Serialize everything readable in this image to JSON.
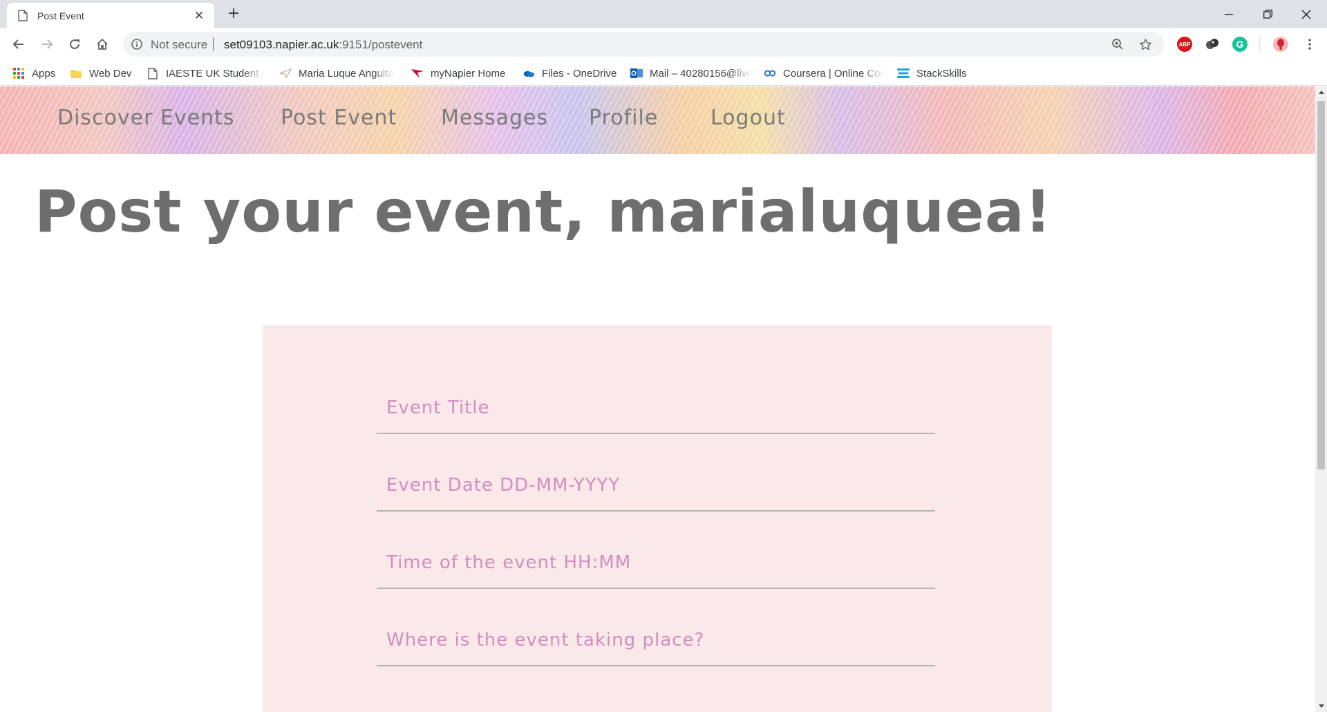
{
  "browser": {
    "tab_title": "Post Event",
    "security_label": "Not secure",
    "url_host": "set09103.napier.ac.uk",
    "url_path": ":9151/postevent",
    "extensions": [
      "abp-icon",
      "ghostery-icon",
      "grammarly-icon",
      "profile-avatar"
    ],
    "bookmarks": [
      {
        "label": "Apps",
        "icon": "apps-grid-icon"
      },
      {
        "label": "Web Dev",
        "icon": "folder-icon"
      },
      {
        "label": "IAESTE UK Student Ap",
        "icon": "page-icon"
      },
      {
        "label": "Maria Luque Anguita",
        "icon": "bird-icon"
      },
      {
        "label": "myNapier Home",
        "icon": "napier-icon"
      },
      {
        "label": "Files - OneDrive",
        "icon": "onedrive-icon"
      },
      {
        "label": "Mail – 40280156@live",
        "icon": "outlook-icon"
      },
      {
        "label": "Coursera | Online Cou",
        "icon": "coursera-icon"
      },
      {
        "label": "StackSkills",
        "icon": "stack-icon"
      }
    ]
  },
  "nav": {
    "items": [
      "Discover Events",
      "Post Event",
      "Messages",
      "Profile",
      "Logout"
    ]
  },
  "page": {
    "heading": "Post your event, marialuquea!"
  },
  "form": {
    "fields": [
      {
        "placeholder": "Event Title"
      },
      {
        "placeholder": "Event Date DD-MM-YYYY"
      },
      {
        "placeholder": "Time of the event HH:MM"
      },
      {
        "placeholder": "Where is the event taking place?"
      }
    ]
  },
  "colors": {
    "nav_text": "#7a7a7a",
    "heading_text": "#6e6e6e",
    "card_bg": "#fbe8e8",
    "placeholder": "#d18ec1"
  }
}
